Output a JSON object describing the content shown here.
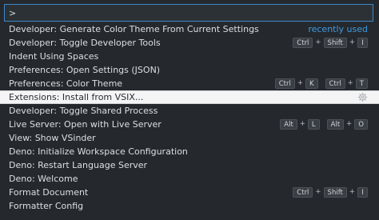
{
  "search": {
    "value": ">"
  },
  "items": [
    {
      "label": "Developer: Generate Color Theme From Current Settings",
      "recent": "recently used"
    },
    {
      "label": "Developer: Toggle Developer Tools",
      "keys": [
        [
          "Ctrl",
          "Shift",
          "I"
        ]
      ]
    },
    {
      "label": "Indent Using Spaces"
    },
    {
      "label": "Preferences: Open Settings (JSON)"
    },
    {
      "label": "Preferences: Color Theme",
      "keys": [
        [
          "Ctrl",
          "K"
        ],
        [
          "Ctrl",
          "T"
        ]
      ]
    },
    {
      "label": "Extensions: Install from VSIX...",
      "selected": true,
      "icon": "gear-icon"
    },
    {
      "label": "Developer: Toggle Shared Process"
    },
    {
      "label": "Live Server: Open with Live Server",
      "keys": [
        [
          "Alt",
          "L"
        ],
        [
          "Alt",
          "O"
        ]
      ]
    },
    {
      "label": "View: Show VSinder"
    },
    {
      "label": "Deno: Initialize Workspace Configuration"
    },
    {
      "label": "Deno: Restart Language Server"
    },
    {
      "label": "Deno: Welcome"
    },
    {
      "label": "Format Document",
      "keys": [
        [
          "Ctrl",
          "Shift",
          "I"
        ]
      ]
    },
    {
      "label": "Formatter Config"
    }
  ],
  "colors": {
    "background": "#25292e",
    "accent": "#3e86c8",
    "recent_link": "#3f9ae0",
    "selected_background": "#f4f4f4"
  }
}
